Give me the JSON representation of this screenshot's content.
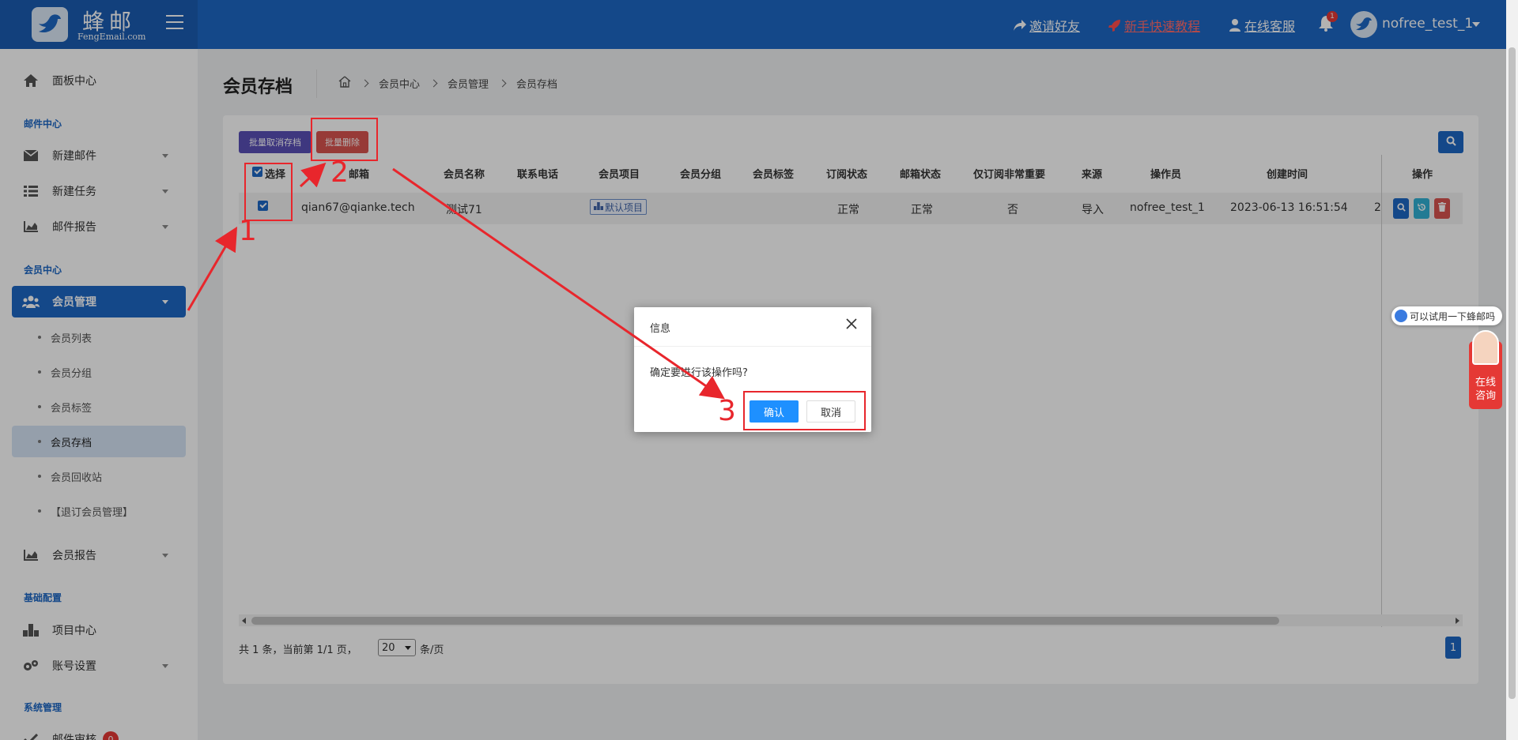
{
  "brand": {
    "name": "蜂邮",
    "domain": "FengEmail.com"
  },
  "header": {
    "invite": "邀请好友",
    "tutorial": "新手快速教程",
    "support": "在线客服",
    "notifications": "1",
    "username": "nofree_test_1"
  },
  "sidebar": {
    "dashboard": "面板中心",
    "sec_mail": "邮件中心",
    "new_mail": "新建邮件",
    "new_task": "新建任务",
    "mail_report": "邮件报告",
    "sec_member": "会员中心",
    "member_mgmt": "会员管理",
    "sub": [
      "会员列表",
      "会员分组",
      "会员标签",
      "会员存档",
      "会员回收站",
      "【退订会员管理】"
    ],
    "member_report": "会员报告",
    "sec_base": "基础配置",
    "project_center": "项目中心",
    "account_settings": "账号设置",
    "sec_system": "系统管理",
    "mail_review": "邮件审核",
    "mail_review_badge": "0"
  },
  "page": {
    "title": "会员存档",
    "breadcrumb": [
      "会员中心",
      "会员管理",
      "会员存档"
    ]
  },
  "toolbar": {
    "cancel_archive": "批量取消存档",
    "batch_delete": "批量删除"
  },
  "table": {
    "headers": [
      "选择",
      "邮箱",
      "会员名称",
      "联系电话",
      "会员项目",
      "会员分组",
      "会员标签",
      "订阅状态",
      "邮箱状态",
      "仅订阅非常重要",
      "来源",
      "操作员",
      "创建时间",
      "操作"
    ],
    "row": {
      "email": "qian67@qianke.tech",
      "name": "测试71",
      "project": "默认项目",
      "sub_status": "正常",
      "mail_status": "正常",
      "important_only": "否",
      "source": "导入",
      "operator": "nofree_test_1",
      "created": "2023-06-13 16:51:54",
      "overflow": "2"
    }
  },
  "pager": {
    "summary": "共 1 条，当前第 1/1 页，",
    "size": "20",
    "per": "条/页",
    "current": "1"
  },
  "modal": {
    "title": "信息",
    "message": "确定要进行该操作吗?",
    "ok": "确认",
    "cancel": "取消"
  },
  "float": {
    "hint": "可以试用一下蜂邮吗",
    "consult_1": "在线",
    "consult_2": "咨询"
  },
  "annotations": [
    "1",
    "2",
    "3"
  ],
  "colors": {
    "primary": "#1e67c4",
    "danger": "#d9534f",
    "annotation": "#e8262c"
  }
}
